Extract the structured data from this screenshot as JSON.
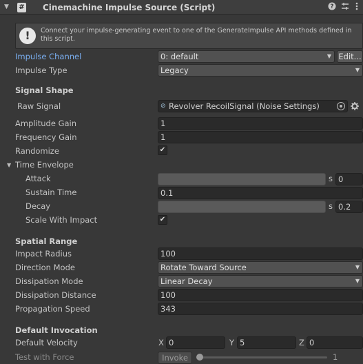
{
  "header": {
    "title": "Cinemachine Impulse Source (Script)",
    "script_icon": "#",
    "icons": [
      "chevron-down-icon",
      "help-icon",
      "presets-icon",
      "kebab-menu-icon"
    ]
  },
  "help": {
    "text": "Connect your impulse-generating event to one of the GenerateImpulse API methods defined in this script.",
    "icon": "!"
  },
  "fields": {
    "impulse_channel": {
      "label": "Impulse Channel",
      "value": "0: default",
      "button": "Edit..."
    },
    "impulse_type": {
      "label": "Impulse Type",
      "value": "Legacy"
    },
    "signal_shape": {
      "header": "Signal Shape"
    },
    "raw_signal": {
      "label": "Raw Signal",
      "value": "Revolver RecoilSignal (Noise Settings)"
    },
    "amplitude_gain": {
      "label": "Amplitude Gain",
      "value": "1"
    },
    "frequency_gain": {
      "label": "Frequency Gain",
      "value": "1"
    },
    "randomize": {
      "label": "Randomize",
      "checked": "✔"
    },
    "time_envelope": {
      "label": "Time Envelope"
    },
    "attack": {
      "label": "Attack",
      "unit": "s",
      "value": "0"
    },
    "sustain_time": {
      "label": "Sustain Time",
      "value": "0.1"
    },
    "decay": {
      "label": "Decay",
      "unit": "s",
      "value": "0.2"
    },
    "scale_with_impact": {
      "label": "Scale With Impact",
      "checked": "✔"
    },
    "spatial_range": {
      "header": "Spatial Range"
    },
    "impact_radius": {
      "label": "Impact Radius",
      "value": "100"
    },
    "direction_mode": {
      "label": "Direction Mode",
      "value": "Rotate Toward Source"
    },
    "dissipation_mode": {
      "label": "Dissipation Mode",
      "value": "Linear Decay"
    },
    "dissipation_distance": {
      "label": "Dissipation Distance",
      "value": "100"
    },
    "propagation_speed": {
      "label": "Propagation Speed",
      "value": "343"
    },
    "default_invocation": {
      "header": "Default Invocation"
    },
    "default_velocity": {
      "label": "Default Velocity",
      "x_label": "X",
      "x": "0",
      "y_label": "Y",
      "y": "5",
      "z_label": "Z",
      "z": "0"
    },
    "test_with_force": {
      "label": "Test with Force",
      "button": "Invoke",
      "value": "1",
      "slider_fraction": 0.0
    }
  },
  "colors": {
    "background": "#383838",
    "accent_label": "#7bb0f2"
  }
}
